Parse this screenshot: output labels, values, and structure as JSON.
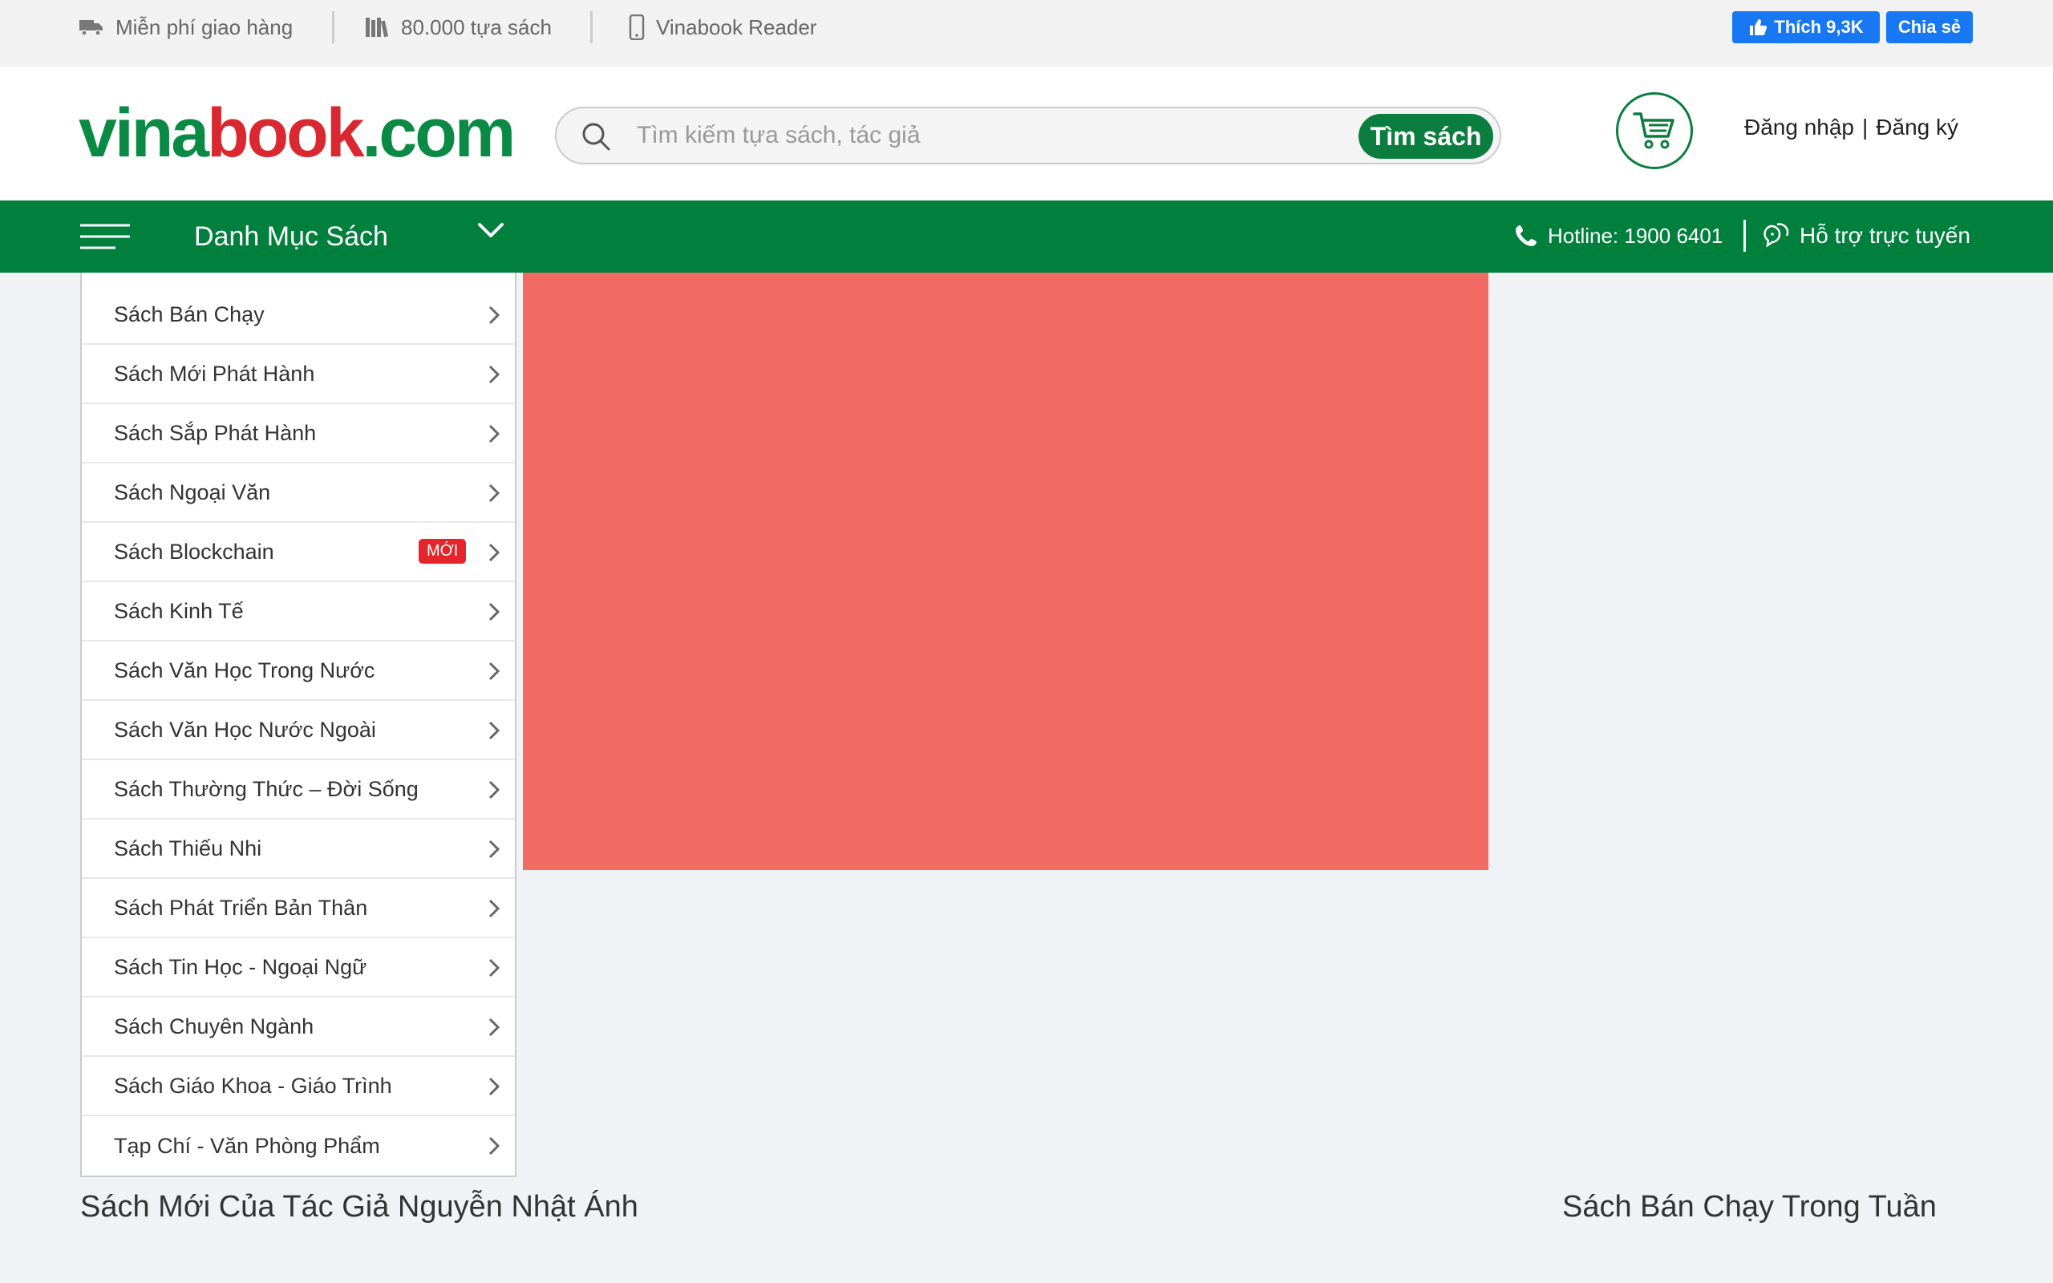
{
  "topbar": {
    "free_shipping": "Miễn phí giao hàng",
    "books_count": "80.000 tựa sách",
    "reader": "Vinabook Reader",
    "fb_like": "Thích 9,3K",
    "fb_share": "Chia sẻ",
    "fb_color": "#1877f2"
  },
  "header": {
    "logo_part1": "vina",
    "logo_part2": "book",
    "logo_part3": ".com",
    "search_placeholder": "Tìm kiếm tựa sách, tác giả",
    "search_button": "Tìm sách",
    "login": "Đăng nhập",
    "divider": "|",
    "register": "Đăng ký",
    "brand_green": "#0b7d3e",
    "brand_red": "#d9282f"
  },
  "nav": {
    "category_title": "Danh Mục Sách",
    "hotline": "Hotline: 1900 6401",
    "support": "Hỗ trợ trực tuyến",
    "bg_color": "#007f3d"
  },
  "categories": [
    {
      "label": "Sách Bán Chạy"
    },
    {
      "label": "Sách Mới Phát Hành"
    },
    {
      "label": "Sách Sắp Phát Hành"
    },
    {
      "label": "Sách Ngoại Văn"
    },
    {
      "label": "Sách Blockchain",
      "badge": "MỚI"
    },
    {
      "label": "Sách Kinh Tế"
    },
    {
      "label": "Sách Văn Học Trong Nước"
    },
    {
      "label": "Sách Văn Học Nước Ngoài"
    },
    {
      "label": "Sách Thường Thức – Đời Sống"
    },
    {
      "label": "Sách Thiếu Nhi"
    },
    {
      "label": "Sách Phát Triển Bản Thân"
    },
    {
      "label": "Sách Tin Học - Ngoại Ngữ"
    },
    {
      "label": "Sách Chuyên Ngành"
    },
    {
      "label": "Sách Giáo Khoa - Giáo Trình"
    },
    {
      "label": "Tạp Chí - Văn Phòng Phẩm"
    }
  ],
  "banner": {
    "color": "#f16b63"
  },
  "sections": {
    "left_title": "Sách Mới Của Tác Giả Nguyễn Nhật Ánh",
    "right_title": "Sách Bán Chạy Trong Tuần"
  }
}
